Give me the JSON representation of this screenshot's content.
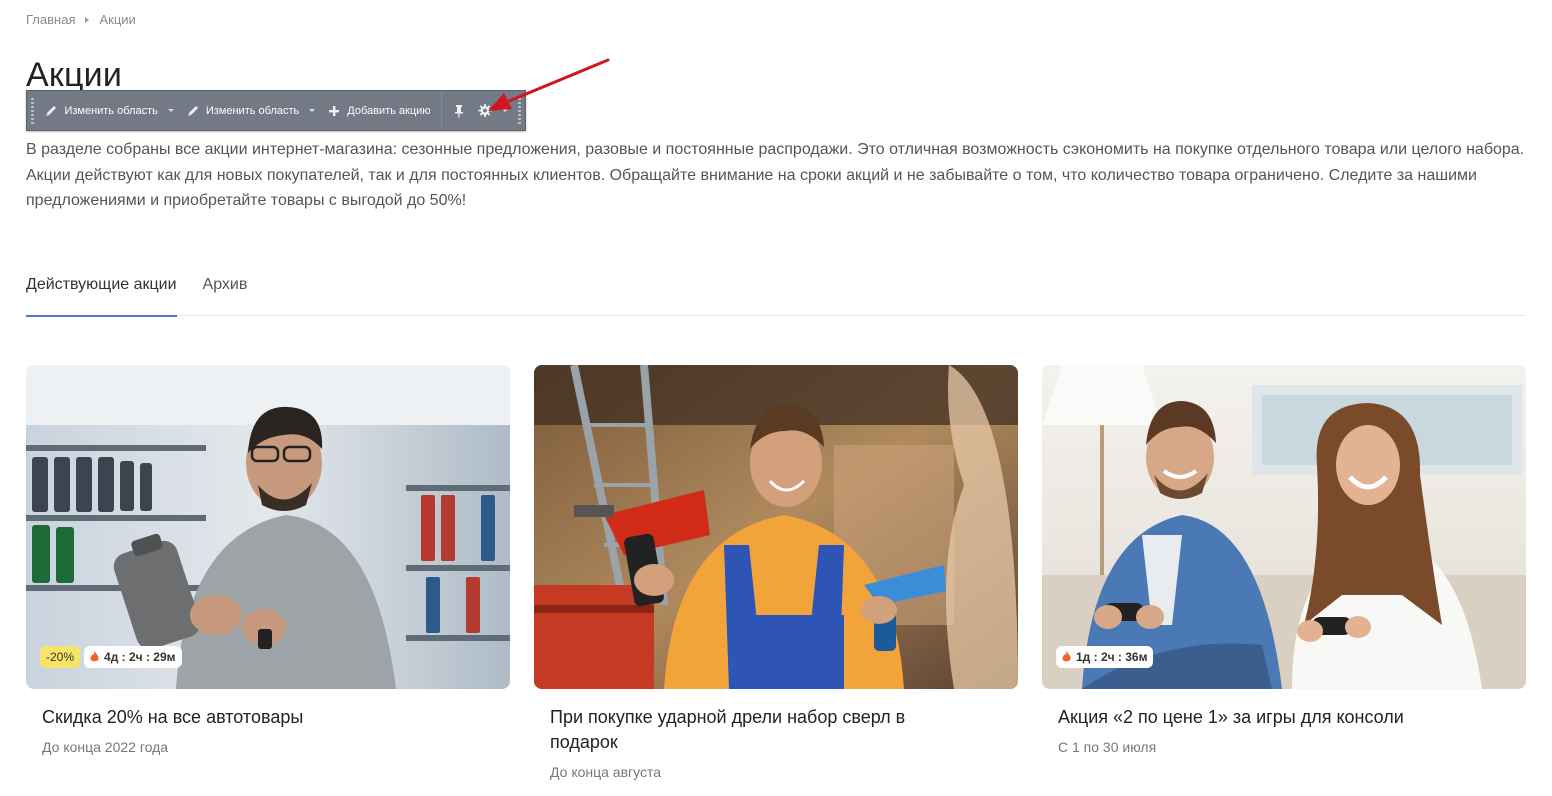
{
  "breadcrumb": {
    "home": "Главная",
    "current": "Акции"
  },
  "page": {
    "title": "Акции",
    "description": "В разделе собраны все акции интернет-магазина: сезонные предложения, разовые и постоянные распродажи. Это отличная возможность сэкономить на покупке отдельного товара или целого набора. Акции действуют как для новых покупателей, так и для постоянных клиентов. Обращайте внимание на сроки акций и не забывайте о том, что количество товара ограничено. Следите за нашими предложениями и приобретайте товары с выгодой до 50%!"
  },
  "edit_panel": {
    "edit_area_1": "Изменить область",
    "edit_area_2": "Изменить область",
    "add_promo": "Добавить акцию",
    "icons": [
      "pencil-icon",
      "pencil-icon",
      "plus-icon",
      "pin-icon",
      "gear-icon"
    ]
  },
  "tabs": [
    {
      "label": "Действующие акции",
      "active": true
    },
    {
      "label": "Архив",
      "active": false
    }
  ],
  "cards": [
    {
      "title": "Скидка 20% на все автотовары",
      "date": "До конца 2022 года",
      "discount": "-20%",
      "timer": "4д : 2ч : 29м"
    },
    {
      "title": "При покупке ударной дрели набор сверл в подарок",
      "date": "До конца августа"
    },
    {
      "title": "Акция «2 по цене 1» за игры для консоли",
      "date": "С 1 по 30 июля",
      "timer": "1д : 2ч : 36м"
    }
  ],
  "colors": {
    "tab_accent": "#4a74d6",
    "panel_bg": "#737985",
    "discount_badge": "#f7e468",
    "arrow": "#d0161f"
  }
}
